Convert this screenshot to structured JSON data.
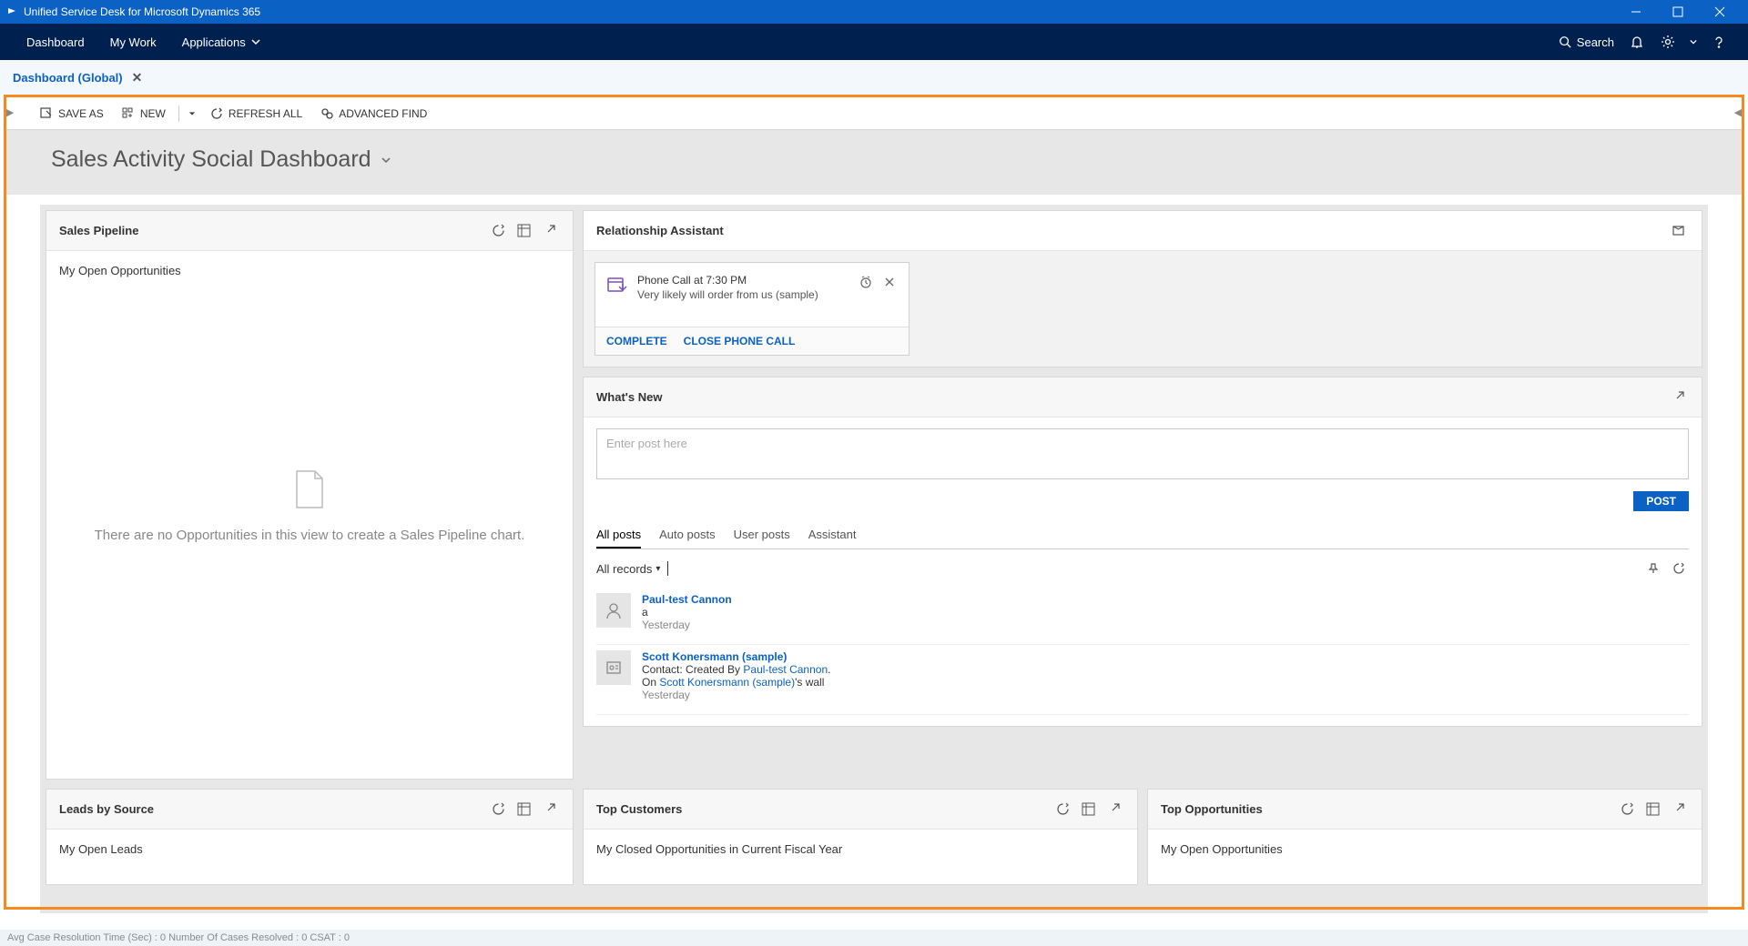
{
  "titlebar": {
    "title": "Unified Service Desk for Microsoft Dynamics 365"
  },
  "nav": {
    "dashboard": "Dashboard",
    "mywork": "My Work",
    "applications": "Applications",
    "search": "Search"
  },
  "tab": {
    "label": "Dashboard (Global)"
  },
  "cmd": {
    "saveas": "SAVE AS",
    "new": "NEW",
    "refresh": "REFRESH ALL",
    "advfind": "ADVANCED FIND"
  },
  "dashboard": {
    "title": "Sales Activity Social Dashboard"
  },
  "pipeline": {
    "title": "Sales Pipeline",
    "subtitle": "My Open Opportunities",
    "empty": "There are no Opportunities in this view to create a Sales Pipeline chart."
  },
  "ra": {
    "title": "Relationship Assistant",
    "card": {
      "title": "Phone Call at 7:30 PM",
      "desc": "Very likely will order from us (sample)",
      "complete": "COMPLETE",
      "close": "CLOSE PHONE CALL"
    }
  },
  "wn": {
    "title": "What's New",
    "placeholder": "Enter post here",
    "post": "POST",
    "tabs": {
      "all": "All posts",
      "auto": "Auto posts",
      "user": "User posts",
      "assistant": "Assistant"
    },
    "filter": "All records",
    "posts": [
      {
        "name": "Paul-test Cannon",
        "body": "a",
        "time": "Yesterday"
      },
      {
        "name": "Scott Konersmann (sample)",
        "prefix": "Contact: Created By ",
        "link1": "Paul-test Cannon",
        "suffix1": ".",
        "line2a": "On ",
        "link2": "Scott Konersmann (sample)",
        "line2b": "'s wall",
        "time": "Yesterday"
      }
    ]
  },
  "leads": {
    "title": "Leads by Source",
    "subtitle": "My Open Leads"
  },
  "topcust": {
    "title": "Top Customers",
    "subtitle": "My Closed Opportunities in Current Fiscal Year"
  },
  "topopp": {
    "title": "Top Opportunities",
    "subtitle": "My Open Opportunities"
  },
  "status": "Avg Case Resolution Time (Sec) :   0   Number Of Cases Resolved :   0   CSAT :   0"
}
